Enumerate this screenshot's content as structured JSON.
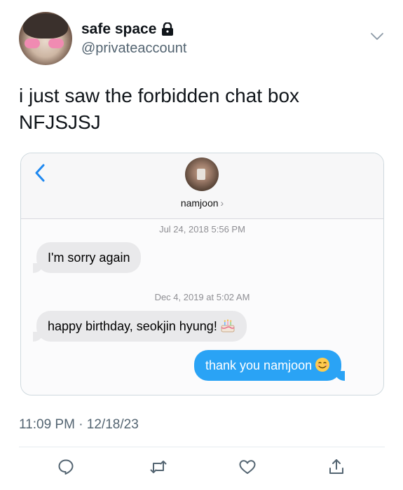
{
  "tweet": {
    "display_name": "safe space",
    "handle": "@privateaccount",
    "text": "i just saw the forbidden chat box\nNFJSJSJ",
    "timestamp": "11:09 PM · 12/18/23"
  },
  "chat": {
    "contact_name": "namjoon",
    "contact_chevron": "›",
    "messages": [
      {
        "timestamp": "Jul 24, 2018 5:56 PM",
        "text": "I'm sorry again",
        "direction": "incoming"
      },
      {
        "timestamp": "Dec 4, 2019 at 5:02 AM",
        "text": "happy birthday, seokjin hyung!",
        "emoji": "birthday-cake",
        "direction": "incoming"
      },
      {
        "text": "thank you namjoon",
        "emoji": "smiling-face",
        "direction": "outgoing"
      }
    ]
  },
  "actions": [
    "reply-icon",
    "retweet-icon",
    "like-icon",
    "share-icon"
  ],
  "colors": {
    "accent": "#2aa3f5",
    "incoming_bubble": "#e9e9eb",
    "secondary_text": "#536471"
  }
}
